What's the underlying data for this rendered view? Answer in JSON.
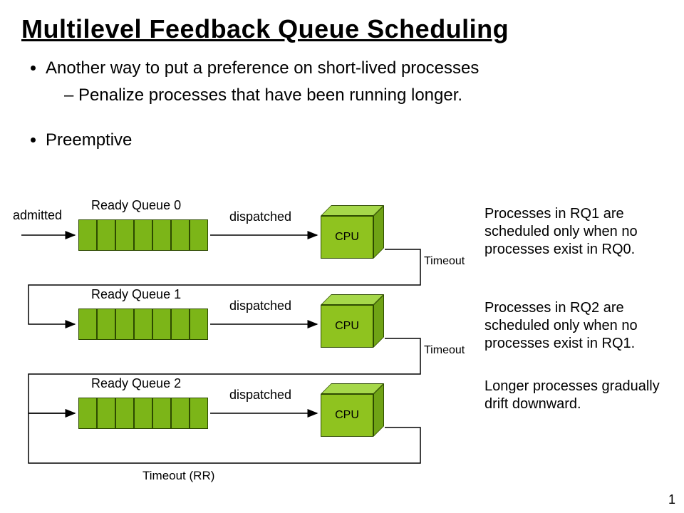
{
  "title": "Multilevel Feedback Queue Scheduling",
  "bullets": {
    "b1": "Another way to put a preference on short-lived processes",
    "b1_sub": "Penalize processes that have been running longer.",
    "b2": "Preemptive"
  },
  "labels": {
    "admitted": "admitted",
    "rq0": "Ready  Queue 0",
    "rq1": "Ready  Queue 1",
    "rq2": "Ready  Queue 2",
    "dispatched": "dispatched",
    "cpu": "CPU",
    "timeout": "Timeout",
    "timeout_rr": "Timeout (RR)"
  },
  "sidetext": {
    "s1": "Processes in RQ1 are scheduled only when no processes exist in RQ0.",
    "s2": "Processes in RQ2 are scheduled only when no processes exist in RQ1.",
    "s3": "Longer processes gradually drift downward."
  },
  "page": "1",
  "diagram": {
    "type": "multilevel-feedback-queue",
    "levels": 3,
    "queues": [
      {
        "name": "Ready Queue 0",
        "slots": 7,
        "input": "admitted",
        "output": "dispatched -> CPU",
        "timeout_to": "Ready Queue 1"
      },
      {
        "name": "Ready Queue 1",
        "slots": 7,
        "output": "dispatched -> CPU",
        "timeout_to": "Ready Queue 2"
      },
      {
        "name": "Ready Queue 2",
        "slots": 7,
        "output": "dispatched -> CPU",
        "timeout_to": "Ready Queue 2 (RR)"
      }
    ]
  }
}
